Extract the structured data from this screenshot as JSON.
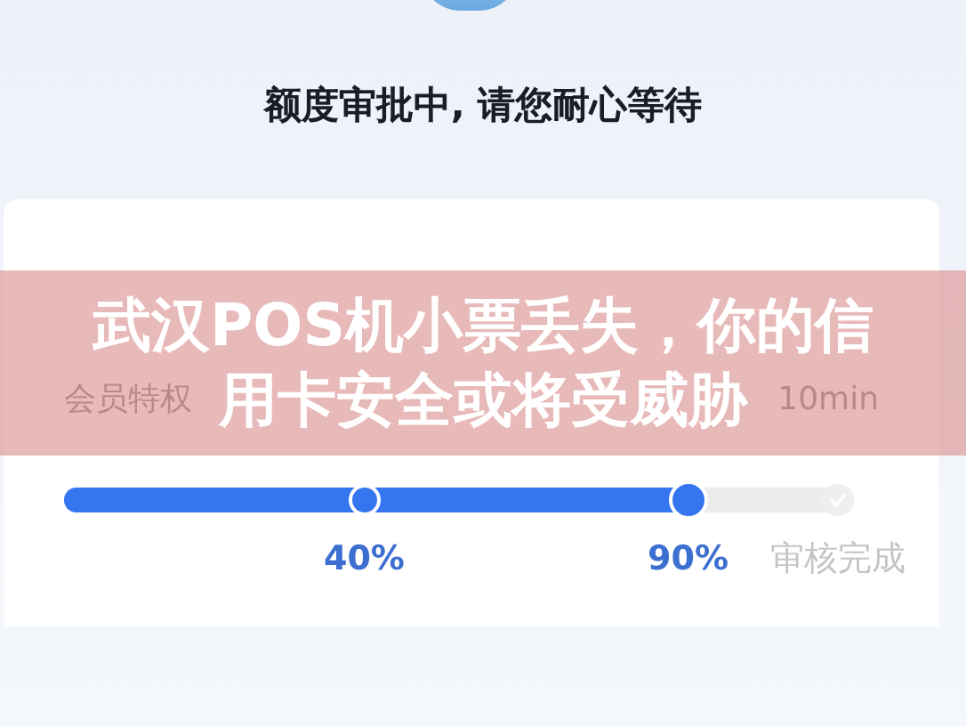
{
  "status_title": "额度审批中, 请您耐心等待",
  "card": {
    "subtitle_left": "会员特权",
    "subtitle_right": "10min",
    "progress": {
      "level": 0.79,
      "steps": [
        {
          "label": "40%",
          "reached": true,
          "current": false
        },
        {
          "label": "90%",
          "reached": true,
          "current": true
        },
        {
          "label": "审核完成",
          "reached": false,
          "current": false
        }
      ]
    }
  },
  "banner": {
    "lines": [
      "武汉POS机小票丢失，你的信",
      "用卡安全或将受威胁"
    ]
  }
}
